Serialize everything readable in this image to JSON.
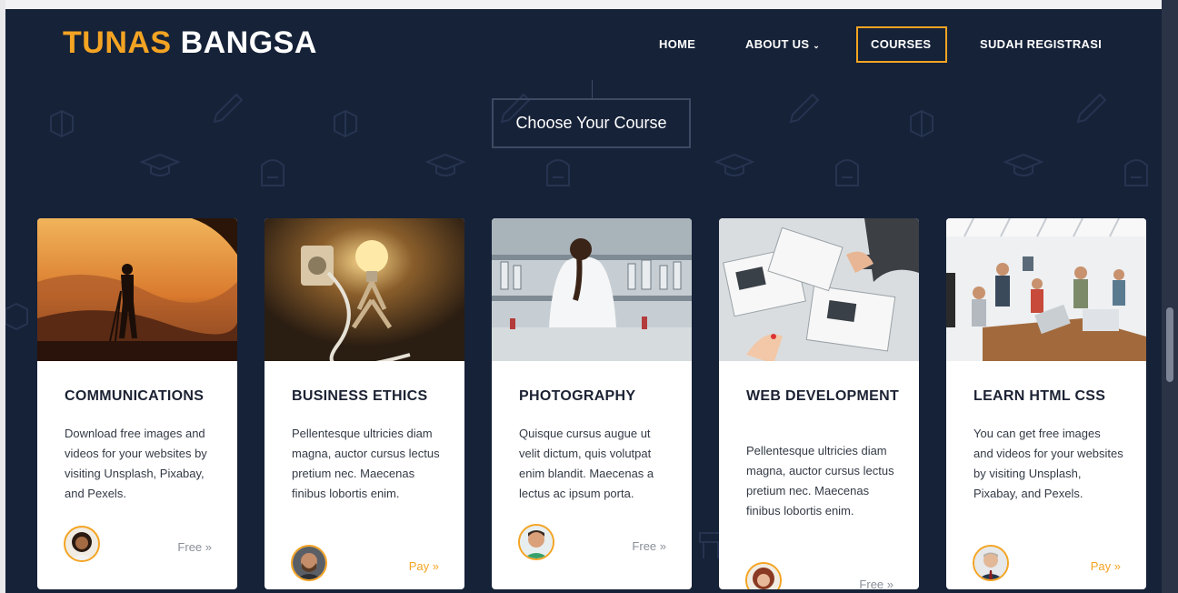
{
  "brand": {
    "part1": "TUNAS",
    "part2": "BANGSA"
  },
  "nav": {
    "home": "HOME",
    "about": "ABOUT US",
    "courses": "COURSES",
    "registered": "SUDAH REGISTRASI"
  },
  "section": {
    "title": "Choose Your Course"
  },
  "courses": [
    {
      "title": "COMMUNICATIONS",
      "description": "Download free images and videos for your websites by visiting Unsplash, Pixabay, and Pexels.",
      "price": "Free »",
      "image": "photographer-sunset",
      "avatar": "woman-curly-hair"
    },
    {
      "title": "BUSINESS ETHICS",
      "description": "Pellentesque ultricies diam magna, auctor cursus lectus pretium nec. Maecenas finibus lobortis enim.",
      "price": "Pay »",
      "image": "lightbulb-figure",
      "avatar": "man-beard"
    },
    {
      "title": "PHOTOGRAPHY",
      "description": "Quisque cursus augue ut velit dictum, quis volutpat enim blandit. Maecenas a lectus ac ipsum porta.",
      "price": "Free »",
      "image": "laboratory-scientist",
      "avatar": "man-smiling-green-shirt"
    },
    {
      "title": "WEB DEVELOPMENT",
      "description": "Pellentesque ultricies diam magna, auctor cursus lectus pretium nec. Maecenas finibus lobortis enim.",
      "price": "Free »",
      "image": "desk-documents-hands",
      "avatar": "woman-red-hair"
    },
    {
      "title": "LEARN HTML CSS",
      "description": "You can get free images and videos for your websites by visiting Unsplash, Pixabay, and Pexels.",
      "price": "Pay »",
      "image": "team-meeting-office",
      "avatar": "man-suit-tie"
    }
  ],
  "colors": {
    "accent": "#f4a423",
    "background": "#162238",
    "card": "#ffffff"
  }
}
